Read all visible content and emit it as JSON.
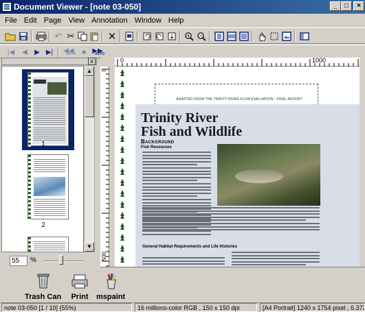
{
  "window": {
    "title": "Document Viewer - [note 03-050]",
    "min_label": "_",
    "max_label": "□",
    "close_label": "×"
  },
  "menu": [
    "File",
    "Edit",
    "Page",
    "View",
    "Annotation",
    "Window",
    "Help"
  ],
  "toolbar2": {
    "prev_auto_label": "AUTO",
    "next_auto_label": "AUTO"
  },
  "thumbnails": {
    "page1_label": "1",
    "page2_label": "2",
    "close_label": "x"
  },
  "zoom": {
    "value": "55",
    "unit": "%",
    "slider_fraction": 0.45
  },
  "ruler": {
    "start_label": "0",
    "end_label": "1000",
    "left_label": "0",
    "left_bottom_label": "500"
  },
  "document": {
    "adapted_from": "ADAPTED FROM THE TRINITY RIVER FLOW EVALUATION - FINAL REPORT",
    "title_line1": "Trinity River",
    "title_line2": "Fish and Wildlife",
    "background_heading": "Background",
    "fish_heading": "Fish Resources",
    "habitat_heading": "General Habitat Requirements and Life Histories"
  },
  "tools": [
    {
      "label": "Trash Can",
      "icon": "trash-can-icon"
    },
    {
      "label": "Print",
      "icon": "printer-icon"
    },
    {
      "label": "mspaint",
      "icon": "paint-icon"
    }
  ],
  "status": {
    "page_info": "note 03-050 [1 / 10] (55%)",
    "color_info": "16 millions-color RGB , 150 x 150 dpi",
    "size_info": "[A4 Portrait]  1240 x 1754 pixel , 6.372"
  }
}
